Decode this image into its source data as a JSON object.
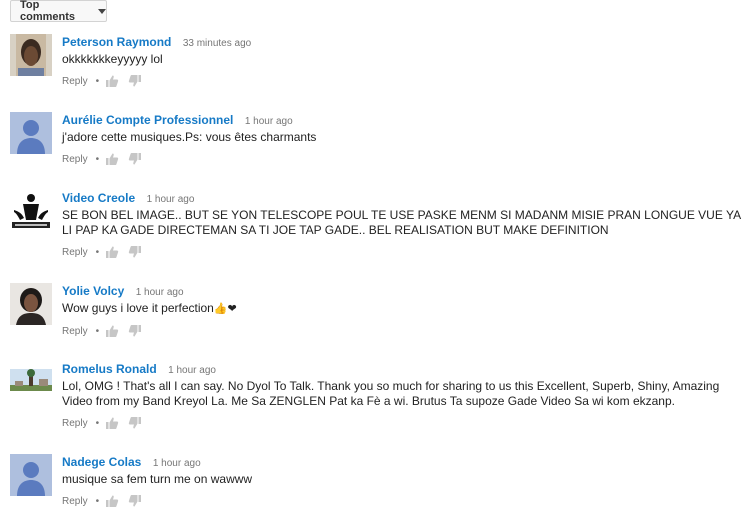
{
  "sort": {
    "label": "Top comments"
  },
  "comments": [
    {
      "author": "Peterson Raymond",
      "time": "33 minutes ago",
      "text": "okkkkkkkeyyyyy lol",
      "reply": "Reply",
      "avatar": "photo-avatar"
    },
    {
      "author": "Aurélie Compte Professionnel",
      "time": "1 hour ago",
      "text": "j'adore cette musiques.Ps: vous êtes charmants",
      "reply": "Reply",
      "avatar": "default-avatar"
    },
    {
      "author": "Video Creole",
      "time": "1 hour ago",
      "text": "SE BON BEL IMAGE.. BUT SE YON TELESCOPE POUL TE USE PASKE MENM SI MADANM MISIE PRAN LONGUE VUE YA LI PAP KA GADE DIRECTEMAN SA TI JOE TAP  GADE.. BEL REALISATION BUT MAKE DEFINITION",
      "reply": "Reply",
      "avatar": "logo-avatar"
    },
    {
      "author": "Yolie Volcy",
      "time": "1 hour ago",
      "text": "Wow guys i love it perfection",
      "emoji": "👍❤",
      "reply": "Reply",
      "avatar": "photo-avatar"
    },
    {
      "author": "Romelus Ronald",
      "time": "1 hour ago",
      "text": "Lol, OMG ! That's all I can say. No Dyol To Talk. Thank you so much for sharing to us this Excellent, Superb, Shiny, Amazing Video from my Band Kreyol La. Me Sa ZENGLEN Pat ka Fè a wi. Brutus Ta supoze Gade Video Sa wi kom ekzanp.",
      "reply": "Reply",
      "avatar": "landscape-avatar"
    },
    {
      "author": "Nadege Colas",
      "time": "1 hour ago",
      "text": "musique sa fem turn me on wawww",
      "reply": "Reply",
      "avatar": "default-avatar"
    }
  ]
}
